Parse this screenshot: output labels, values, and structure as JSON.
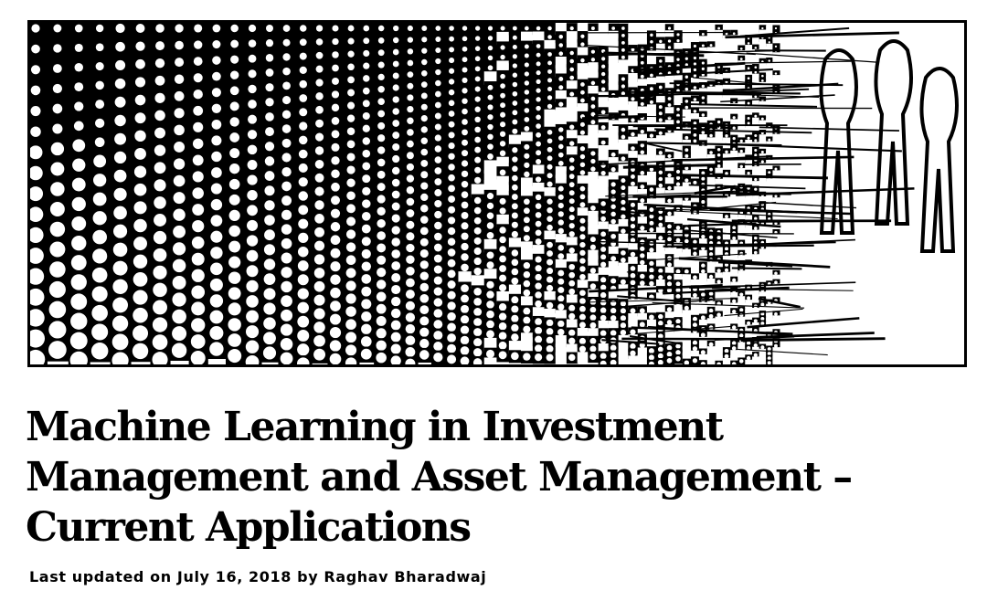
{
  "hero_image": {
    "alt": "Halftone dot pattern banner image",
    "icon": "halftone-banner-image"
  },
  "article": {
    "title": "Machine Learning in Investment Management and Asset Management – Current Applications",
    "byline": {
      "prefix": "Last updated on",
      "date": "July 16, 2018",
      "by": "by",
      "author": "Raghav Bharadwaj"
    }
  },
  "colors": {
    "text": "#000000",
    "background": "#ffffff"
  }
}
